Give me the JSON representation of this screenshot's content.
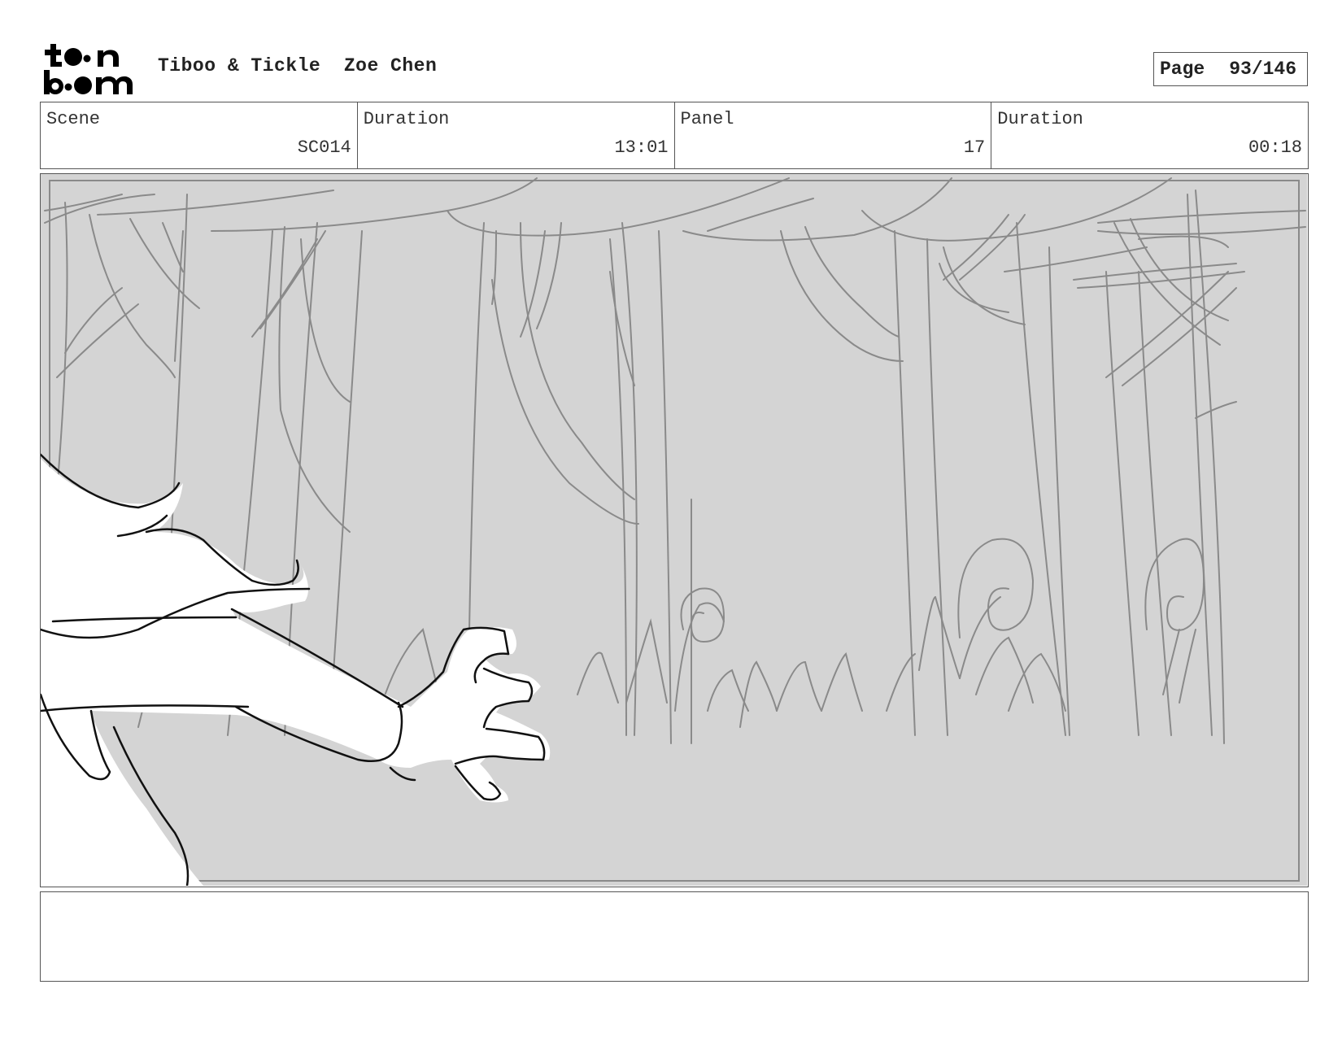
{
  "header": {
    "logo_text": "toon boom",
    "project": "Tiboo & Tickle",
    "artist": "Zoe Chen",
    "page_label": "Page",
    "page_number": "93/146"
  },
  "info": {
    "scene_label": "Scene",
    "scene_value": "SC014",
    "scene_duration_label": "Duration",
    "scene_duration_value": "13:01",
    "panel_label": "Panel",
    "panel_value": "17",
    "panel_duration_label": "Duration",
    "panel_duration_value": "00:18"
  },
  "panel_image": {
    "icon": "forest-sketch-with-clawed-arm",
    "background_color": "#d4d4d4",
    "line_color": "#8a8a8a"
  },
  "notes": {
    "text": ""
  }
}
